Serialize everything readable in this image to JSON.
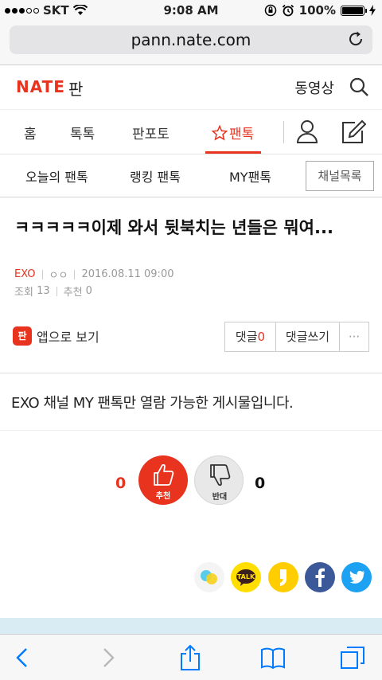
{
  "status_bar": {
    "carrier": "SKT",
    "time": "9:08 AM",
    "battery": "100%"
  },
  "browser": {
    "url": "pann.nate.com"
  },
  "header": {
    "logo": "NATE",
    "section": "판",
    "video_link": "동영상"
  },
  "main_nav": {
    "items": [
      "홈",
      "톡톡",
      "판포토",
      "팬톡"
    ],
    "active_index": 3
  },
  "sub_nav": {
    "items": [
      "오늘의 팬톡",
      "랭킹 팬톡",
      "MY팬톡"
    ],
    "channel_button": "채널목록"
  },
  "post": {
    "title": "ㅋㅋㅋㅋㅋ이제 와서 뒷북치는 년들은 뭐여...",
    "category": "EXO",
    "author": "ㅇㅇ",
    "datetime": "2016.08.11 09:00",
    "views_label": "조회",
    "views": "13",
    "recommend_label": "추천",
    "recommend": "0",
    "app_view": "앱으로 보기",
    "app_icon_text": "판",
    "comment_label": "댓글",
    "comment_count": "0",
    "write_comment": "댓글쓰기",
    "more": "···",
    "notice": "EXO 채널 MY 팬톡만 열람 가능한 게시물입니다."
  },
  "vote": {
    "up_count": "0",
    "up_label": "추천",
    "down_count": "0",
    "down_label": "반대"
  },
  "share": {
    "talk_label": "TALK"
  },
  "colors": {
    "brand": "#e8331f",
    "facebook": "#3b5998",
    "twitter": "#1da1f2",
    "kakao": "#ffde00",
    "ios_blue": "#007aff"
  }
}
